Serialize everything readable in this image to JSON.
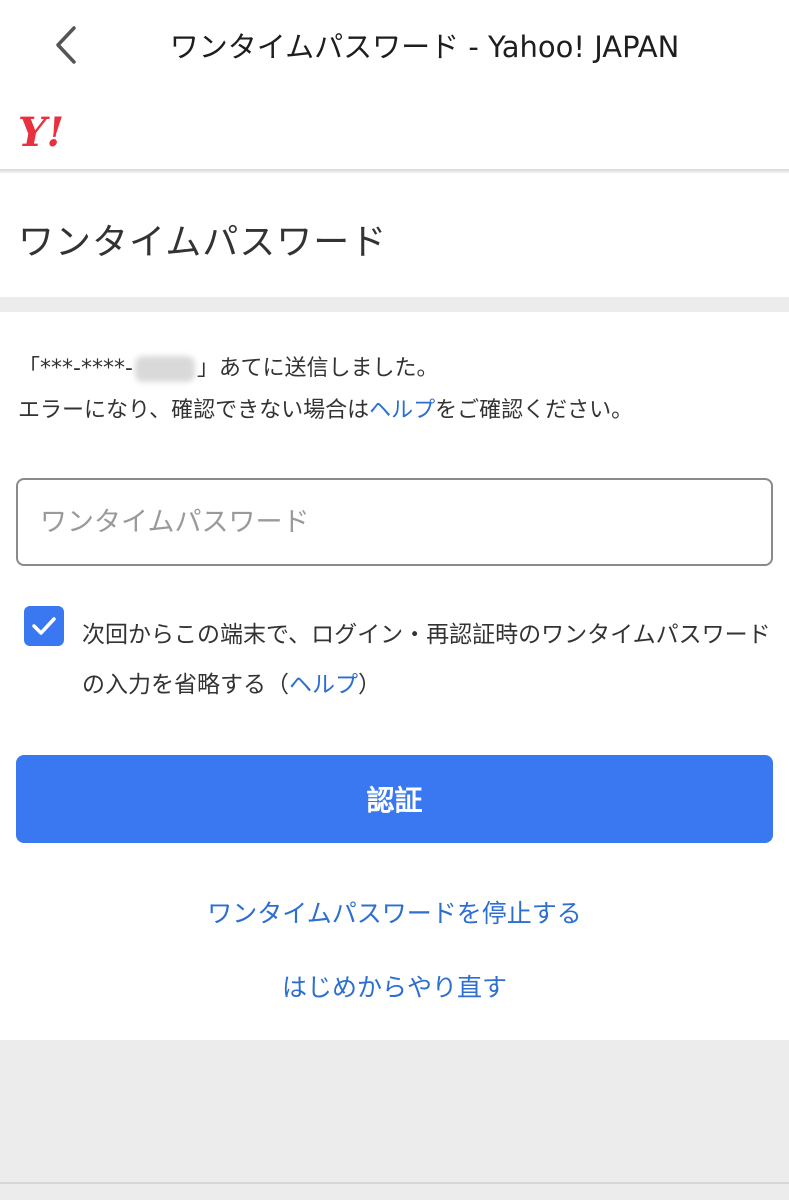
{
  "header": {
    "title": "ワンタイムパスワード - Yahoo! JAPAN",
    "back_icon": "chevron-left-icon"
  },
  "brand": {
    "logo_text": "Y!",
    "logo_color": "#e8303e"
  },
  "page": {
    "title": "ワンタイムパスワード"
  },
  "info": {
    "line1_open": "「",
    "phone_masked": "***-****-",
    "line1_close": "」あてに送信しました。",
    "line2_prefix": "エラーになり、確認できない場合は",
    "line2_link": "ヘルプ",
    "line2_suffix": "をご確認ください。"
  },
  "otp": {
    "placeholder": "ワンタイムパスワード",
    "value": ""
  },
  "remember": {
    "checked": true,
    "label_prefix": "次回からこの端末で、ログイン・再認証時のワンタイムパスワードの入力を省略する（",
    "label_link": "ヘルプ",
    "label_suffix": "）"
  },
  "actions": {
    "submit_label": "認証",
    "stop_otp_label": "ワンタイムパスワードを停止する",
    "restart_label": "はじめからやり直す"
  },
  "colors": {
    "accent": "#3a78f2",
    "link": "#2d6fd1",
    "background": "#ececec"
  }
}
